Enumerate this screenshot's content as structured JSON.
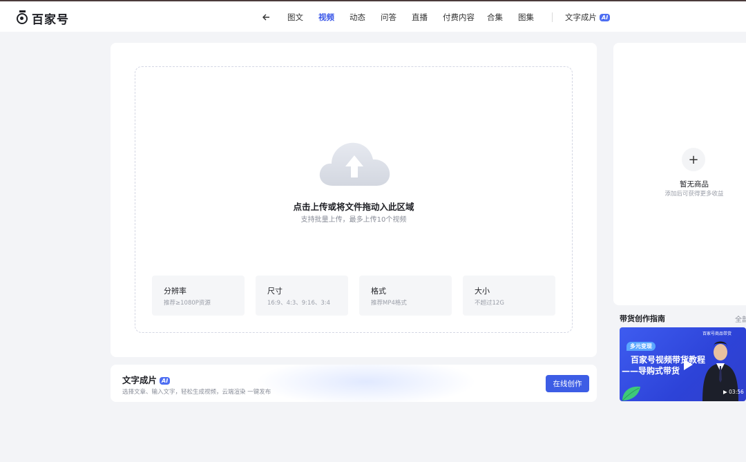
{
  "brand": {
    "name": "百家号"
  },
  "nav": {
    "items": [
      {
        "label": "图文",
        "active": false
      },
      {
        "label": "视频",
        "active": true
      },
      {
        "label": "动态",
        "active": false
      },
      {
        "label": "问答",
        "active": false
      },
      {
        "label": "直播",
        "active": false
      },
      {
        "label": "付费内容",
        "active": false
      },
      {
        "label": "合集",
        "active": false
      },
      {
        "label": "图集",
        "active": false
      }
    ],
    "ai_feature": {
      "label": "文字成片",
      "badge": "AI"
    }
  },
  "upload": {
    "title": "点击上传或将文件拖动入此区域",
    "subtitle": "支持批量上传，最多上传10个视频",
    "specs": [
      {
        "title": "分辨率",
        "desc": "推荐≥1080P资源"
      },
      {
        "title": "尺寸",
        "desc": "16:9、4:3、9:16、3:4"
      },
      {
        "title": "格式",
        "desc": "推荐MP4格式"
      },
      {
        "title": "大小",
        "desc": "不超过12G"
      }
    ]
  },
  "text_to_video": {
    "title": "文字成片",
    "badge": "AI",
    "desc": "选择文章、输入文字，轻松生成视频，云端渲染 一键发布",
    "button": "在线创作"
  },
  "goods": {
    "add_label": "+",
    "empty_title": "暂无商品",
    "empty_hint": "添加后可获得更多收益"
  },
  "guide": {
    "title": "带货创作指南",
    "all_label": "全部",
    "video": {
      "brand": "百家号商品带货",
      "tag": "多元变现",
      "line1": "百家号视频带货教程",
      "line2": "——导购式带货",
      "duration": "03:56"
    }
  },
  "colors": {
    "accent": "#3d5de5",
    "active_nav": "#3a57e8",
    "ai_badge": "#4e6ef2"
  }
}
